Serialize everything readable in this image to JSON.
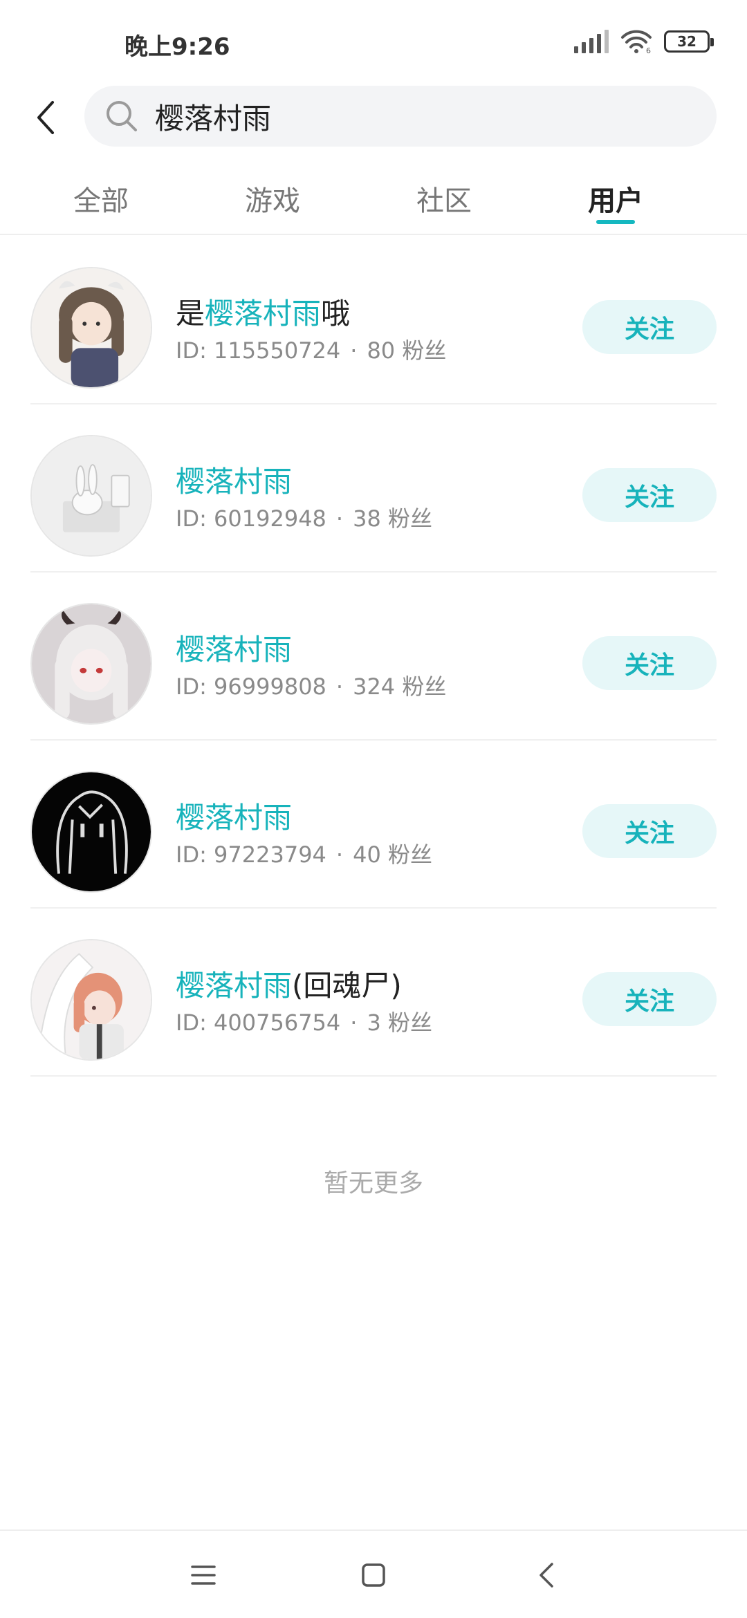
{
  "status_bar": {
    "time": "晚上9:26",
    "battery": "32",
    "wifi_badge": "6"
  },
  "header": {
    "search_query": "樱落村雨",
    "back_icon": "chevron-left-icon",
    "search_icon": "magnifier-icon"
  },
  "tabs": [
    {
      "label": "全部",
      "active": false
    },
    {
      "label": "游戏",
      "active": false
    },
    {
      "label": "社区",
      "active": false
    },
    {
      "label": "用户",
      "active": true
    }
  ],
  "users": [
    {
      "prefix": "是",
      "highlight": "樱落村雨",
      "suffix": "哦",
      "id": "ID: 115550724",
      "fans": "80 粉丝",
      "follow": "关注"
    },
    {
      "prefix": "",
      "highlight": "樱落村雨",
      "suffix": "",
      "id": "ID: 60192948",
      "fans": "38 粉丝",
      "follow": "关注"
    },
    {
      "prefix": "",
      "highlight": "樱落村雨",
      "suffix": "",
      "id": "ID: 96999808",
      "fans": "324 粉丝",
      "follow": "关注"
    },
    {
      "prefix": "",
      "highlight": "樱落村雨",
      "suffix": "",
      "id": "ID: 97223794",
      "fans": "40 粉丝",
      "follow": "关注"
    },
    {
      "prefix": "",
      "highlight": "樱落村雨",
      "suffix": "(回魂尸)",
      "id": "ID: 400756754",
      "fans": "3 粉丝",
      "follow": "关注"
    }
  ],
  "dot": "·",
  "footer_text": "暂无更多",
  "colors": {
    "accent": "#17b3bb",
    "follow_bg": "#e6f7f8",
    "search_bg": "#f3f4f6"
  },
  "nav_bar": {
    "menu_icon": "menu-icon",
    "home_icon": "home-square-icon",
    "back_icon": "back-triangle-icon"
  }
}
